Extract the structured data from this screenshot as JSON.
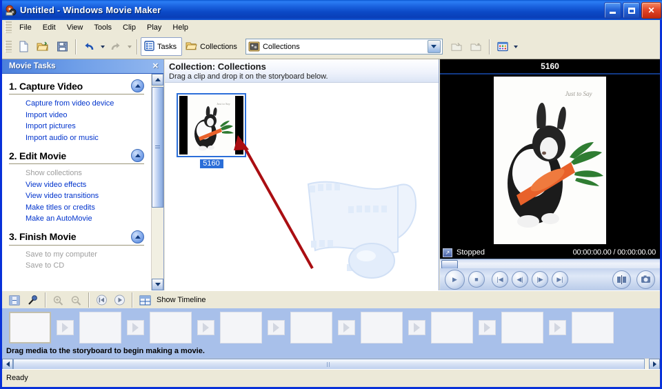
{
  "window": {
    "title": "Untitled - Windows Movie Maker",
    "app_icon": "movie-maker-icon",
    "minimize": "_",
    "maximize": "□",
    "close": "✕"
  },
  "menu": {
    "items": [
      "File",
      "Edit",
      "View",
      "Tools",
      "Clip",
      "Play",
      "Help"
    ]
  },
  "toolbar": {
    "new_icon": "new-project-icon",
    "open_icon": "open-project-icon",
    "save_icon": "save-project-icon",
    "undo_icon": "undo-icon",
    "redo_icon": "redo-icon",
    "tasks_label": "Tasks",
    "tasks_icon": "tasks-list-icon",
    "collections_label": "Collections",
    "collections_icon": "collections-folder-icon",
    "combo_value": "Collections",
    "combo_icon": "collection-reel-icon",
    "new_collection_icon": "new-collection-folder-icon",
    "up_folder_icon": "up-one-level-folder-icon",
    "views_icon": "views-icon"
  },
  "tasks_pane": {
    "header": "Movie Tasks",
    "close": "✕",
    "sections": [
      {
        "title": "1. Capture Video",
        "items": [
          {
            "label": "Capture from video device",
            "disabled": false
          },
          {
            "label": "Import video",
            "disabled": false
          },
          {
            "label": "Import pictures",
            "disabled": false
          },
          {
            "label": "Import audio or music",
            "disabled": false
          }
        ]
      },
      {
        "title": "2. Edit Movie",
        "items": [
          {
            "label": "Show collections",
            "disabled": true
          },
          {
            "label": "View video effects",
            "disabled": false
          },
          {
            "label": "View video transitions",
            "disabled": false
          },
          {
            "label": "Make titles or credits",
            "disabled": false
          },
          {
            "label": "Make an AutoMovie",
            "disabled": false
          }
        ]
      },
      {
        "title": "3. Finish Movie",
        "items": [
          {
            "label": "Save to my computer",
            "disabled": true
          },
          {
            "label": "Save to CD",
            "disabled": true
          }
        ]
      }
    ]
  },
  "collection_pane": {
    "title": "Collection: Collections",
    "subtitle": "Drag a clip and drop it on the storyboard below.",
    "clips": [
      {
        "name": "5160",
        "selected": true
      }
    ],
    "watermark": "film-strip-music-note-watermark",
    "annotation": "red-arrow-pointing-to-clip"
  },
  "monitor": {
    "title": "5160",
    "status": "Stopped",
    "timecode": "00:00:00.00 / 00:00:00.00",
    "fullscreen_icon": "full-screen-icon",
    "buttons": [
      {
        "name": "play-button",
        "glyph": "▶"
      },
      {
        "name": "stop-button",
        "glyph": "■"
      },
      {
        "name": "previous-frame-button",
        "glyph": "|◀"
      },
      {
        "name": "back-button",
        "glyph": "◀|"
      },
      {
        "name": "forward-button",
        "glyph": "|▶"
      },
      {
        "name": "next-frame-button",
        "glyph": "▶|"
      }
    ],
    "split_icon": "split-clip-icon",
    "snapshot_icon": "take-picture-icon"
  },
  "storyboard": {
    "toolbar": {
      "storyboard_icon": "storyboard-view-icon",
      "narrate_icon": "narrate-timeline-microphone-icon",
      "zoom_in_icon": "zoom-in-icon",
      "zoom_out_icon": "zoom-out-icon",
      "rewind_icon": "rewind-storyboard-icon",
      "play_icon": "play-storyboard-icon",
      "timeline_icon": "show-timeline-icon",
      "timeline_label": "Show Timeline"
    },
    "hint": "Drag media to the storyboard to begin making a movie.",
    "cell_count": 9,
    "transition_count": 8
  },
  "status_bar": {
    "text": "Ready"
  },
  "colors": {
    "title_blue": "#0a3fb8",
    "frame_blue": "#0831d9",
    "panel_beige": "#ece9d8",
    "link_blue": "#0033cc",
    "selection_blue": "#2b6ed8",
    "storyboard_blue": "#a8c0ea",
    "annotation_red": "#aa0e12"
  }
}
